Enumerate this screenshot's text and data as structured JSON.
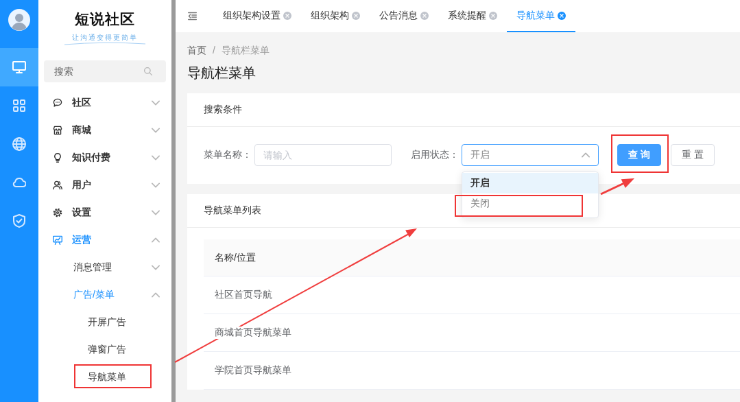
{
  "rail": {
    "items": [
      {
        "selected": true
      },
      {
        "selected": false
      },
      {
        "selected": false
      },
      {
        "selected": false
      },
      {
        "selected": false
      }
    ]
  },
  "sidebar": {
    "logo": "短说社区",
    "slogan": "让沟通变得更简单",
    "search": {
      "placeholder": "搜索"
    },
    "menu": [
      {
        "label": "社区",
        "selected": false,
        "expanded": false
      },
      {
        "label": "商城",
        "selected": false,
        "expanded": false
      },
      {
        "label": "知识付费",
        "selected": false,
        "expanded": false
      },
      {
        "label": "用户",
        "selected": false,
        "expanded": false
      },
      {
        "label": "设置",
        "selected": false,
        "expanded": false
      },
      {
        "label": "运营",
        "selected": true,
        "expanded": true,
        "children": [
          {
            "label": "消息管理",
            "selected": false,
            "expanded": false
          },
          {
            "label": "广告/菜单",
            "selected": true,
            "expanded": true,
            "children": [
              {
                "label": "开屏广告",
                "selected": false
              },
              {
                "label": "弹窗广告",
                "selected": false
              },
              {
                "label": "导航菜单",
                "selected": false,
                "highlighted": true
              }
            ]
          }
        ]
      }
    ]
  },
  "tabs": [
    {
      "label": "组织架构设置",
      "selected": false
    },
    {
      "label": "组织架构",
      "selected": false
    },
    {
      "label": "公告消息",
      "selected": false
    },
    {
      "label": "系统提醒",
      "selected": false
    },
    {
      "label": "导航菜单",
      "selected": true
    }
  ],
  "breadcrumb": {
    "items": [
      "首页",
      "导航栏菜单"
    ],
    "separator": "/"
  },
  "page_title": "导航栏菜单",
  "search_panel": {
    "title": "搜索条件",
    "fields": [
      {
        "kind": "input",
        "label": "菜单名称：",
        "placeholder": "请输入"
      },
      {
        "kind": "select",
        "label": "启用状态：",
        "value": "开启",
        "expanded": true,
        "options": [
          {
            "label": "开启",
            "selected": true
          },
          {
            "label": "关闭",
            "selected": false,
            "highlighted": true
          }
        ]
      }
    ],
    "buttons": [
      {
        "kind": "primary",
        "label": "查 询",
        "highlighted": true
      },
      {
        "kind": "plain",
        "label": "重 置"
      }
    ]
  },
  "list_panel": {
    "title": "导航菜单列表",
    "table": {
      "columns": [
        "名称/位置"
      ],
      "rows": [
        [
          "社区首页导航"
        ],
        [
          "商城首页导航菜单"
        ],
        [
          "学院首页导航菜单"
        ]
      ]
    }
  }
}
